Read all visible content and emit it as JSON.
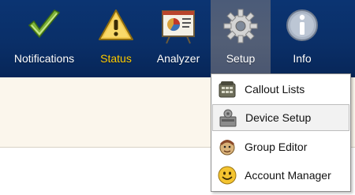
{
  "toolbar": {
    "items": [
      {
        "label": "Notifications",
        "icon": "checkmark-icon"
      },
      {
        "label": "Status",
        "icon": "warning-icon",
        "active": true
      },
      {
        "label": "Analyzer",
        "icon": "chart-board-icon"
      },
      {
        "label": "Setup",
        "icon": "gear-icon",
        "selected": true
      },
      {
        "label": "Info",
        "icon": "info-icon"
      }
    ],
    "colors": {
      "bar": "#0a2f68",
      "active_label": "#ffcc00",
      "selected_bg": "#535f76"
    }
  },
  "setup_menu": {
    "items": [
      {
        "label": "Callout Lists",
        "icon": "phone-list-icon"
      },
      {
        "label": "Device Setup",
        "icon": "device-icon",
        "hovered": true
      },
      {
        "label": "Group Editor",
        "icon": "group-editor-icon"
      },
      {
        "label": "Account Manager",
        "icon": "smiley-icon"
      }
    ]
  }
}
